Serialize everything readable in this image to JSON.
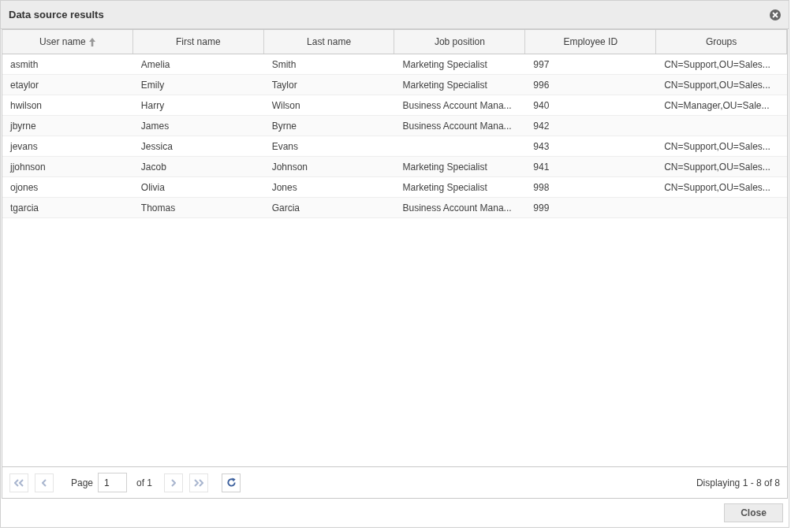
{
  "window": {
    "title": "Data source results"
  },
  "table": {
    "columns": [
      {
        "label": "User name",
        "sorted": true
      },
      {
        "label": "First name",
        "sorted": false
      },
      {
        "label": "Last name",
        "sorted": false
      },
      {
        "label": "Job position",
        "sorted": false
      },
      {
        "label": "Employee ID",
        "sorted": false
      },
      {
        "label": "Groups",
        "sorted": false
      }
    ],
    "rows": [
      [
        "asmith",
        "Amelia",
        "Smith",
        "Marketing Specialist",
        "997",
        "CN=Support,OU=Sales..."
      ],
      [
        "etaylor",
        "Emily",
        "Taylor",
        "Marketing Specialist",
        "996",
        "CN=Support,OU=Sales..."
      ],
      [
        "hwilson",
        "Harry",
        "Wilson",
        "Business Account Mana...",
        "940",
        "CN=Manager,OU=Sale..."
      ],
      [
        "jbyrne",
        "James",
        "Byrne",
        "Business Account Mana...",
        "942",
        ""
      ],
      [
        "jevans",
        "Jessica",
        "Evans",
        "",
        "943",
        "CN=Support,OU=Sales..."
      ],
      [
        "jjohnson",
        "Jacob",
        "Johnson",
        "Marketing Specialist",
        "941",
        "CN=Support,OU=Sales..."
      ],
      [
        "ojones",
        "Olivia",
        "Jones",
        "Marketing Specialist",
        "998",
        "CN=Support,OU=Sales..."
      ],
      [
        "tgarcia",
        "Thomas",
        "Garcia",
        "Business Account Mana...",
        "999",
        ""
      ]
    ]
  },
  "pager": {
    "first": {
      "disabled": true
    },
    "prev": {
      "disabled": true
    },
    "page_label": "Page",
    "page_value": "1",
    "of_label": "of 1",
    "next": {
      "disabled": true
    },
    "last": {
      "disabled": true
    },
    "status": "Displaying 1 - 8 of 8"
  },
  "buttons": [
    "Close"
  ]
}
